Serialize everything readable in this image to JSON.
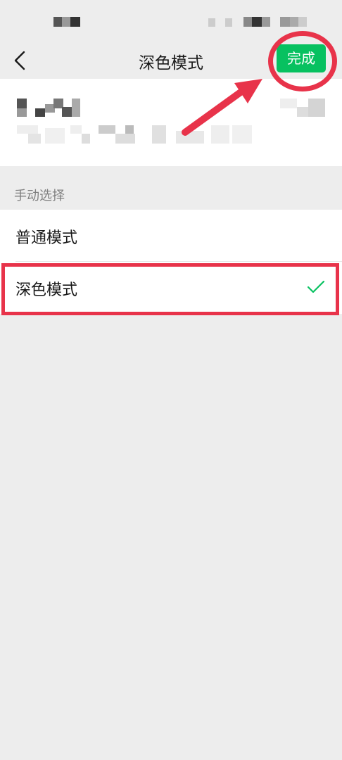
{
  "navbar": {
    "title": "深色模式",
    "done_label": "完成"
  },
  "section": {
    "label": "手动选择"
  },
  "options": [
    {
      "label": "普通模式",
      "selected": false
    },
    {
      "label": "深色模式",
      "selected": true
    }
  ],
  "colors": {
    "accent": "#07c160",
    "annotation": "#e8334a",
    "background": "#ededed"
  },
  "icons": {
    "back": "chevron-left-icon",
    "check": "checkmark-icon"
  }
}
